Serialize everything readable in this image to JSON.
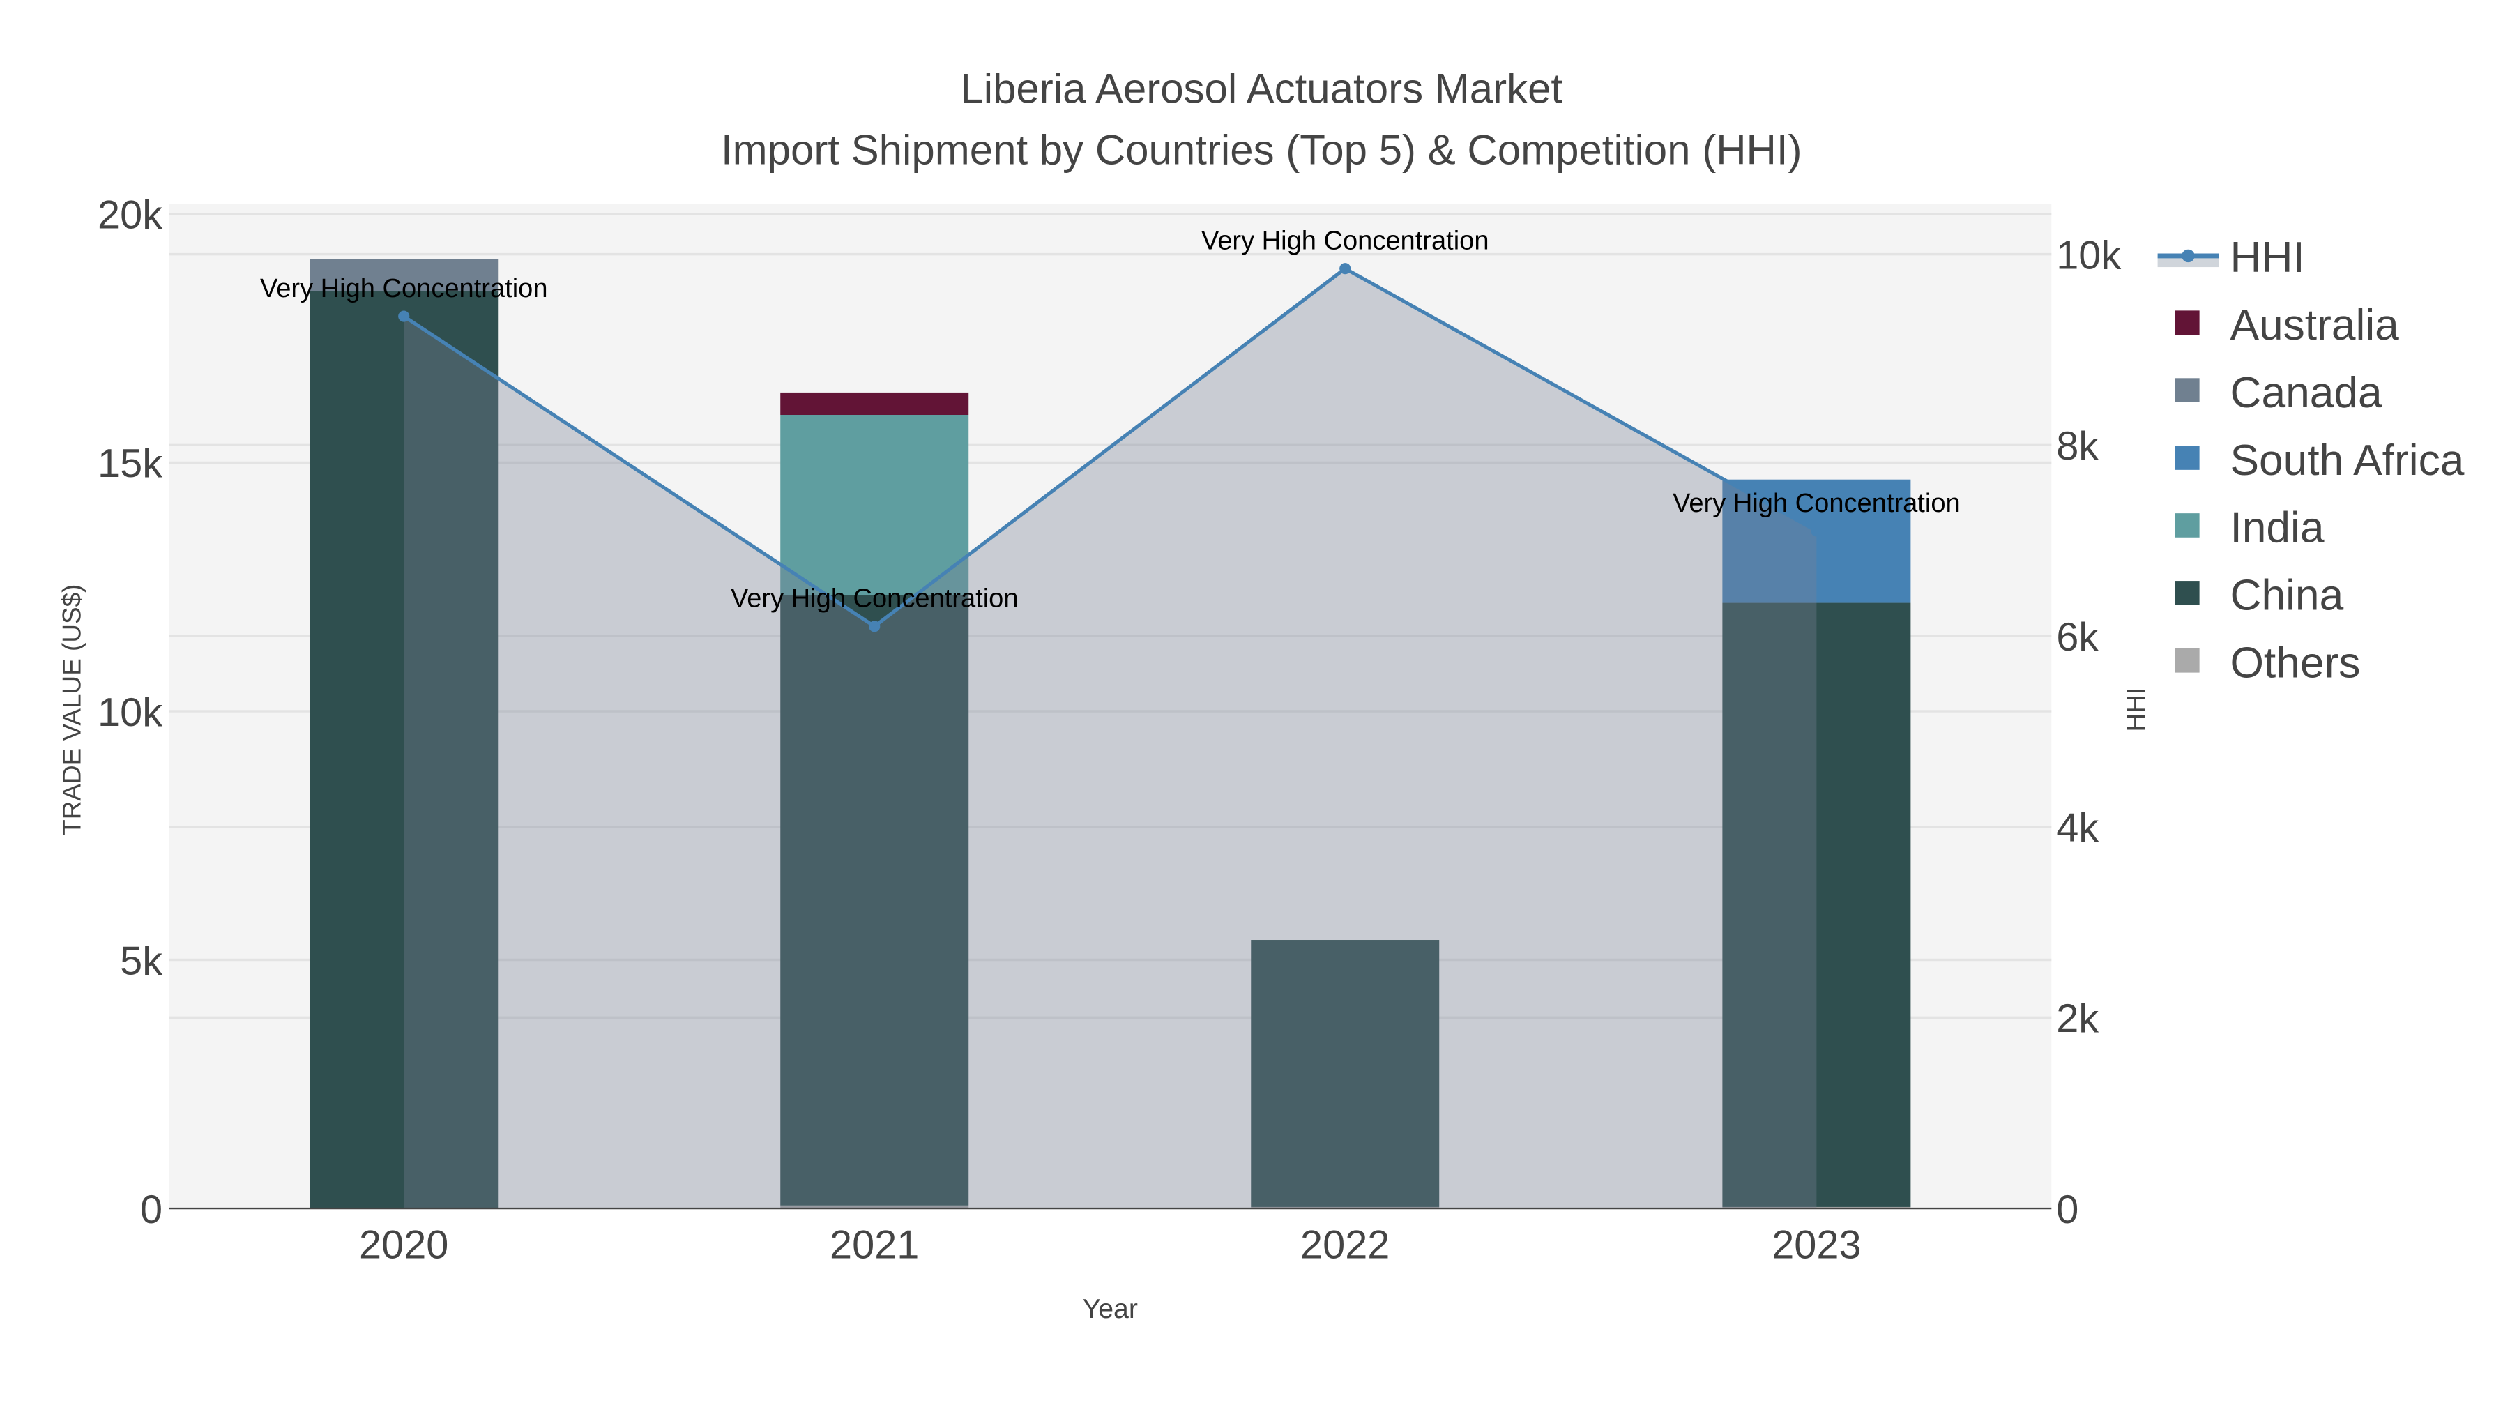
{
  "chart_data": {
    "type": "bar",
    "title": "Liberia Aerosol Actuators Market",
    "subtitle": "Import Shipment by Countries (Top 5) & Competition (HHI)",
    "xlabel": "Year",
    "ylabel": "TRADE VALUE (US$)",
    "y2label": "HHI",
    "categories": [
      "2020",
      "2021",
      "2022",
      "2023"
    ],
    "ylim": [
      0,
      20000
    ],
    "y2lim": [
      0,
      10400
    ],
    "yticks": [
      {
        "v": 0,
        "label": "0"
      },
      {
        "v": 5000,
        "label": "5k"
      },
      {
        "v": 10000,
        "label": "10k"
      },
      {
        "v": 15000,
        "label": "15k"
      },
      {
        "v": 20000,
        "label": "20k"
      }
    ],
    "y2ticks": [
      {
        "v": 0,
        "label": "0"
      },
      {
        "v": 2000,
        "label": "2k"
      },
      {
        "v": 4000,
        "label": "4k"
      },
      {
        "v": 6000,
        "label": "6k"
      },
      {
        "v": 8000,
        "label": "8k"
      },
      {
        "v": 10000,
        "label": "10k"
      }
    ],
    "stacked": true,
    "series": [
      {
        "name": "Others",
        "color": "#aaaaaa",
        "values": [
          0,
          60,
          30,
          30
        ]
      },
      {
        "name": "China",
        "color": "#2f4f4f",
        "values": [
          18450,
          12270,
          5370,
          12150
        ]
      },
      {
        "name": "India",
        "color": "#5f9ea0",
        "values": [
          0,
          3630,
          0,
          0
        ]
      },
      {
        "name": "South Africa",
        "color": "#4682b4",
        "values": [
          0,
          0,
          0,
          2480
        ]
      },
      {
        "name": "Canada",
        "color": "#708090",
        "values": [
          650,
          0,
          0,
          0
        ]
      },
      {
        "name": "Australia",
        "color": "#621436",
        "values": [
          0,
          450,
          0,
          0
        ]
      }
    ],
    "line": {
      "name": "HHI",
      "color": "#4682b4",
      "axis": "y2",
      "values": [
        9350,
        6100,
        9850,
        7100
      ],
      "labels": [
        "Very High Concentration",
        "Very High Concentration",
        "Very High Concentration",
        "Very High Concentration"
      ]
    },
    "legend": {
      "placement": "right",
      "order": [
        "HHI",
        "Australia",
        "Canada",
        "South Africa",
        "India",
        "China",
        "Others"
      ]
    },
    "grid": true
  }
}
